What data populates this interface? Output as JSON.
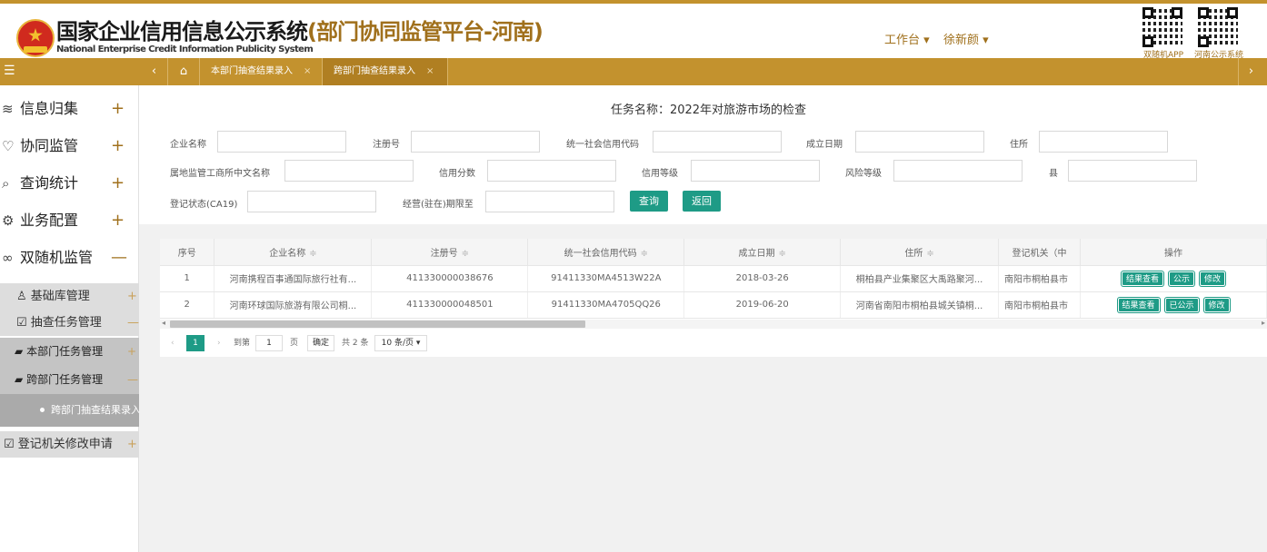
{
  "header": {
    "title": "国家企业信用信息公示系统",
    "title_suffix": "(部门协同监管平台-河南)",
    "subtitle": "National Enterprise Credit Information Publicity System",
    "workbench": "工作台 ▾",
    "user": "徐新颜 ▾",
    "qr1_label": "双随机APP",
    "qr2_label": "河南公示系统"
  },
  "tabbar": {
    "menu_icon": "☰",
    "prev": "‹",
    "home": "⌂",
    "next": "›",
    "tabs": [
      {
        "label": "本部门抽查结果录入",
        "close": "×"
      },
      {
        "label": "跨部门抽查结果录入",
        "close": "×"
      }
    ]
  },
  "sidebar": {
    "items": [
      {
        "label": "信息归集",
        "icon": "≋",
        "toggle": "+"
      },
      {
        "label": "协同监管",
        "icon": "♡",
        "toggle": "+"
      },
      {
        "label": "查询统计",
        "icon": "⌕",
        "toggle": "+"
      },
      {
        "label": "业务配置",
        "icon": "⚙",
        "toggle": "+"
      },
      {
        "label": "双随机监管",
        "icon": "∞",
        "toggle": "—"
      }
    ],
    "sub": [
      {
        "label": "基础库管理",
        "icon": "♙",
        "toggle": "+"
      },
      {
        "label": "抽查任务管理",
        "icon": "☑",
        "toggle": "—"
      }
    ],
    "sub2": [
      {
        "label": "本部门任务管理",
        "icon": "▰",
        "toggle": "+"
      },
      {
        "label": "跨部门任务管理",
        "icon": "▰",
        "toggle": "—"
      }
    ],
    "active": "跨部门抽查结果录入",
    "last": {
      "label": "登记机关修改申请",
      "icon": "☑",
      "toggle": "+"
    }
  },
  "form": {
    "task_title": "任务名称：2022年对旅游市场的检查",
    "labels": {
      "company_name": "企业名称",
      "reg_no": "注册号",
      "credit_code": "统一社会信用代码",
      "est_date": "成立日期",
      "address": "住所",
      "bureau": "属地监管工商所中文名称",
      "credit_score": "信用分数",
      "credit_level": "信用等级",
      "risk_level": "风险等级",
      "county": "县",
      "reg_status": "登记状态(CA19)",
      "op_period": "经营(驻在)期限至"
    },
    "query_button": "查询",
    "back_button": "返回"
  },
  "table": {
    "columns": [
      "序号",
      "企业名称",
      "注册号",
      "统一社会信用代码",
      "成立日期",
      "住所",
      "登记机关（中",
      "操作"
    ],
    "sort_icon": "≑",
    "rows": [
      {
        "no": "1",
        "name": "河南携程百事通国际旅行社有...",
        "reg_no": "411330000038676",
        "code": "91411330MA4513W22A",
        "date": "2018-03-26",
        "address": "桐柏县产业集聚区大禹路聚河...",
        "authority": "南阳市桐柏县市",
        "ops": [
          "结果查看",
          "公示",
          "修改"
        ]
      },
      {
        "no": "2",
        "name": "河南环球国际旅游有限公司桐...",
        "reg_no": "411330000048501",
        "code": "91411330MA4705QQ26",
        "date": "2019-06-20",
        "address": "河南省南阳市桐柏县城关镇桐...",
        "authority": "南阳市桐柏县市",
        "ops": [
          "结果查看",
          "已公示",
          "修改"
        ]
      }
    ]
  },
  "pagination": {
    "prev": "‹",
    "current": "1",
    "next": "›",
    "goto_label": "到第",
    "goto_value": "1",
    "page_unit": "页",
    "confirm": "确定",
    "total": "共 2 条",
    "page_size": "10 条/页 ▾"
  },
  "colors": {
    "accent": "#c3922e",
    "button": "#1e9b86"
  }
}
